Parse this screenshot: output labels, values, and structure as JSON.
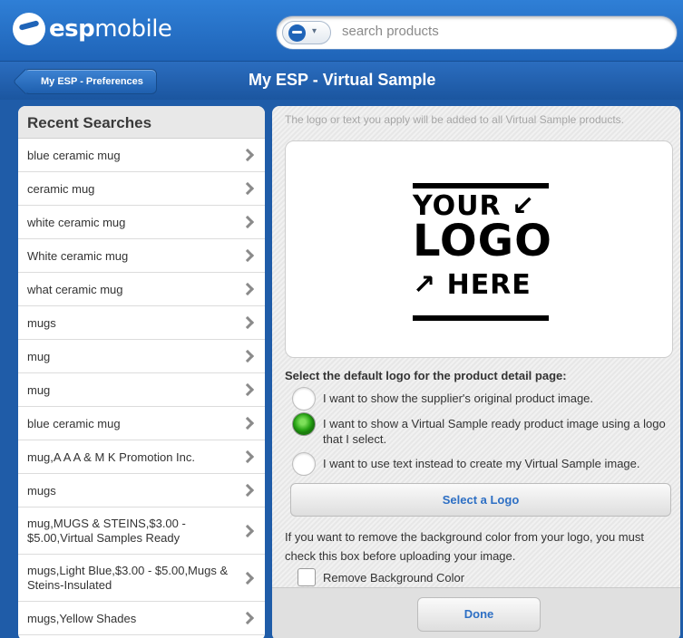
{
  "header": {
    "logo_text_bold": "esp",
    "logo_text_regular": "mobile",
    "search_placeholder": "search products"
  },
  "nav": {
    "back_label": "My ESP - Preferences",
    "title": "My ESP - Virtual Sample"
  },
  "recent_searches": {
    "title": "Recent Searches",
    "items": [
      "blue ceramic mug",
      "ceramic mug",
      "white ceramic mug",
      "White ceramic mug",
      "what ceramic mug",
      "mugs",
      "mug",
      "mug",
      "blue ceramic mug",
      "mug,A A A & M K Promotion Inc.",
      "mugs",
      "mug,MUGS & STEINS,$3.00 - $5.00,Virtual Samples Ready",
      "mugs,Light Blue,$3.00 - $5.00,Mugs & Steins-Insulated",
      "mugs,Yellow Shades"
    ]
  },
  "virtual_sample": {
    "hint": "The logo or text you apply will be added to all Virtual Sample products.",
    "placeholder_logo": {
      "line1": "YOUR ↙",
      "line2": "LOGO",
      "line3": "↗ HERE"
    },
    "select_title": "Select the default logo for the product detail page:",
    "options": [
      {
        "label": "I want to show the supplier's original product image.",
        "selected": false
      },
      {
        "label": "I want to show a Virtual Sample ready product image using a logo that I select.",
        "selected": true
      },
      {
        "label": "I want to use text instead to create my Virtual Sample image.",
        "selected": false
      }
    ],
    "select_logo_button": "Select a Logo",
    "remove_bg_text": "If you want to remove the background color from your logo, you must check this box before uploading your image.",
    "remove_bg_label": "Remove Background Color",
    "remove_bg_checked": false,
    "done_button": "Done"
  },
  "colors": {
    "brand_blue": "#1f64b8",
    "link_blue": "#2d6fc4",
    "selected_green": "#27a414"
  }
}
